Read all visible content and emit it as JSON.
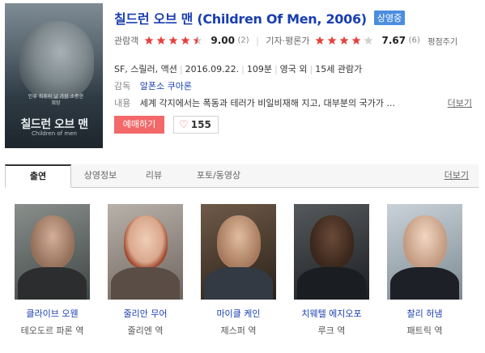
{
  "poster": {
    "title": "칠드런 오브 맨",
    "subtitle": "Children of men",
    "tagline": "인류 최후의 날 가장 소중한 희망"
  },
  "movie": {
    "title": "칠드런 오브 맨 (Children Of Men, 2006)",
    "status_badge": "상영중"
  },
  "ratings": {
    "audience_label": "관람객",
    "audience_stars": 4.5,
    "audience_score": "9.00",
    "audience_count": "(2)",
    "critic_label": "기자·평론가",
    "critic_stars": 4,
    "critic_score": "7.67",
    "critic_count": "(6)",
    "rate_link": "평점주기"
  },
  "info": {
    "genre": "SF, 스릴러, 액션",
    "release": "2016.09.22.",
    "runtime": "109분",
    "country": "영국 외",
    "grade": "15세 관람가"
  },
  "director": {
    "key": "감독",
    "value": "알폰소 쿠아론"
  },
  "plot": {
    "key": "내용",
    "value": "세계 각지에서는 폭동과 테러가 비일비재해 지고, 대부분의 국가가 ...",
    "more": "더보기"
  },
  "buttons": {
    "reserve": "예매하기",
    "like_count": "155"
  },
  "tabs": {
    "items": [
      "출연",
      "상영정보",
      "리뷰",
      "포토/동영상"
    ],
    "more": "더보기"
  },
  "cast": [
    {
      "name": "클라이브 오웬",
      "role": "테오도르 파론 역"
    },
    {
      "name": "줄리안 무어",
      "role": "줄리엔 역"
    },
    {
      "name": "마이클 케인",
      "role": "제스퍼 역"
    },
    {
      "name": "치웨텔 에지오포",
      "role": "루크 역"
    },
    {
      "name": "찰리 허냄",
      "role": "패트릭 역"
    }
  ],
  "colors": {
    "title_blue": "#1a3fb0",
    "badge_blue": "#4c8ddf",
    "star_red": "#e8413c",
    "reserve_red": "#f36868"
  }
}
